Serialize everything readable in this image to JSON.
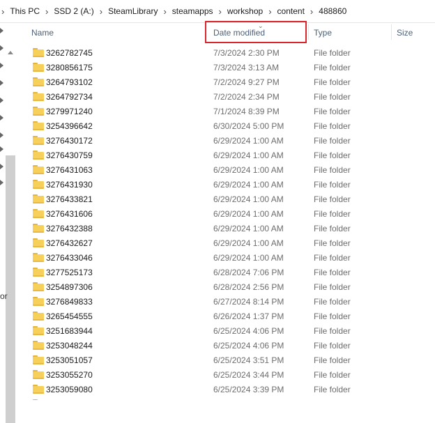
{
  "breadcrumb": [
    "This PC",
    "SSD 2 (A:)",
    "SteamLibrary",
    "steamapps",
    "workshop",
    "content",
    "488860"
  ],
  "breadcrumb_separator": "›",
  "nav_fragment": "or",
  "columns": {
    "name": "Name",
    "date_modified": "Date modified",
    "type": "Type",
    "size": "Size"
  },
  "sort": {
    "column": "date_modified",
    "direction": "descending"
  },
  "highlight_color": "#d9262c",
  "files": [
    {
      "name": "3262782745",
      "date": "7/3/2024 2:30 PM",
      "type": "File folder"
    },
    {
      "name": "3280856175",
      "date": "7/3/2024 3:13 AM",
      "type": "File folder"
    },
    {
      "name": "3264793102",
      "date": "7/2/2024 9:27 PM",
      "type": "File folder"
    },
    {
      "name": "3264792734",
      "date": "7/2/2024 2:34 PM",
      "type": "File folder"
    },
    {
      "name": "3279971240",
      "date": "7/1/2024 8:39 PM",
      "type": "File folder"
    },
    {
      "name": "3254396642",
      "date": "6/30/2024 5:00 PM",
      "type": "File folder"
    },
    {
      "name": "3276430172",
      "date": "6/29/2024 1:00 AM",
      "type": "File folder"
    },
    {
      "name": "3276430759",
      "date": "6/29/2024 1:00 AM",
      "type": "File folder"
    },
    {
      "name": "3276431063",
      "date": "6/29/2024 1:00 AM",
      "type": "File folder"
    },
    {
      "name": "3276431930",
      "date": "6/29/2024 1:00 AM",
      "type": "File folder"
    },
    {
      "name": "3276433821",
      "date": "6/29/2024 1:00 AM",
      "type": "File folder"
    },
    {
      "name": "3276431606",
      "date": "6/29/2024 1:00 AM",
      "type": "File folder"
    },
    {
      "name": "3276432388",
      "date": "6/29/2024 1:00 AM",
      "type": "File folder"
    },
    {
      "name": "3276432627",
      "date": "6/29/2024 1:00 AM",
      "type": "File folder"
    },
    {
      "name": "3276433046",
      "date": "6/29/2024 1:00 AM",
      "type": "File folder"
    },
    {
      "name": "3277525173",
      "date": "6/28/2024 7:06 PM",
      "type": "File folder"
    },
    {
      "name": "3254897306",
      "date": "6/28/2024 2:56 PM",
      "type": "File folder"
    },
    {
      "name": "3276849833",
      "date": "6/27/2024 8:14 PM",
      "type": "File folder"
    },
    {
      "name": "3265454555",
      "date": "6/26/2024 1:37 PM",
      "type": "File folder"
    },
    {
      "name": "3251683944",
      "date": "6/25/2024 4:06 PM",
      "type": "File folder"
    },
    {
      "name": "3253048244",
      "date": "6/25/2024 4:06 PM",
      "type": "File folder"
    },
    {
      "name": "3253051057",
      "date": "6/25/2024 3:51 PM",
      "type": "File folder"
    },
    {
      "name": "3253055270",
      "date": "6/25/2024 3:44 PM",
      "type": "File folder"
    },
    {
      "name": "3253059080",
      "date": "6/25/2024 3:39 PM",
      "type": "File folder"
    }
  ]
}
